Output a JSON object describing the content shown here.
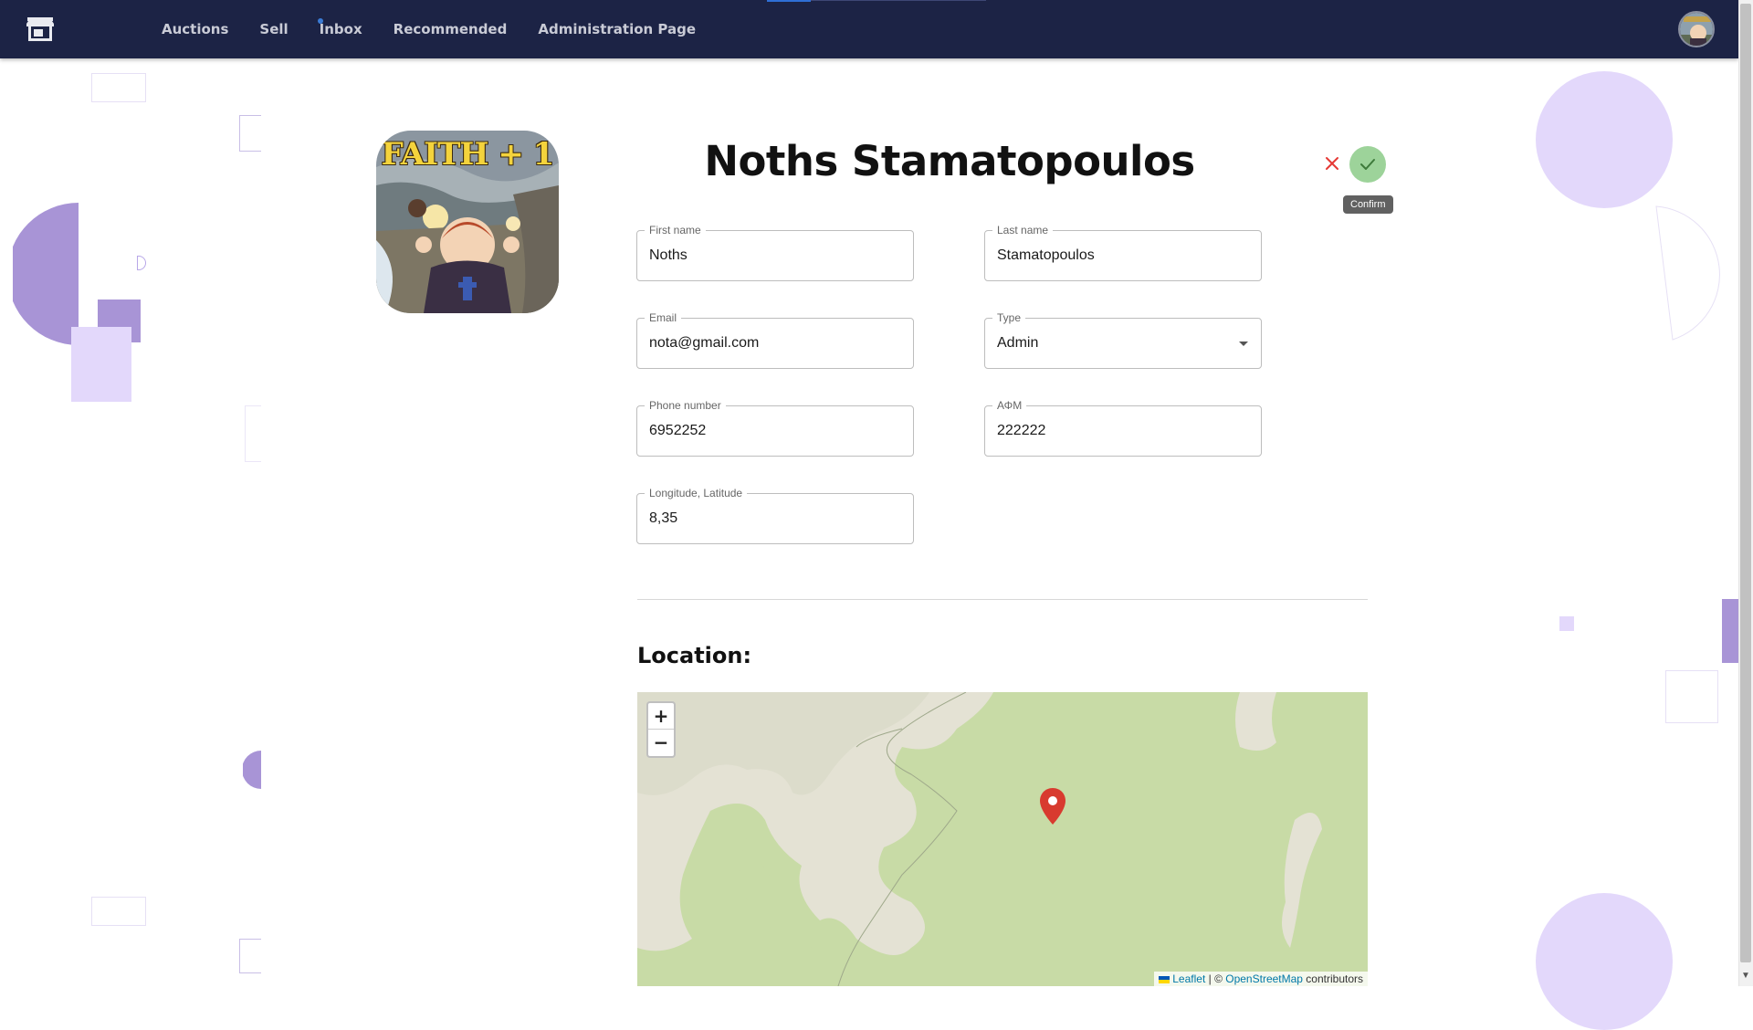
{
  "nav": {
    "links": [
      "Auctions",
      "Sell",
      "Inbox",
      "Recommended",
      "Administration Page"
    ],
    "brand_icon": "store-icon",
    "user_avatar": "avatar"
  },
  "profile": {
    "full_name": "Noths Stamatopoulos",
    "picture_caption": "FAITH + 1"
  },
  "actions": {
    "cancel_icon": "close-icon",
    "confirm_icon": "check-icon",
    "confirm_tooltip": "Confirm"
  },
  "form": {
    "first_name": {
      "label": "First name",
      "value": "Noths"
    },
    "last_name": {
      "label": "Last name",
      "value": "Stamatopoulos"
    },
    "email": {
      "label": "Email",
      "value": "nota@gmail.com"
    },
    "type": {
      "label": "Type",
      "value": "Admin"
    },
    "phone": {
      "label": "Phone number",
      "value": "6952252"
    },
    "afm": {
      "label": "ΑΦΜ",
      "value": "222222"
    },
    "coords": {
      "label": "Longitude, Latitude",
      "value": "8,35"
    }
  },
  "location": {
    "heading": "Location:",
    "zoom_in": "+",
    "zoom_out": "−",
    "attribution_leaflet": "Leaflet",
    "attribution_sep": " | © ",
    "attribution_osm": "OpenStreetMap",
    "attribution_tail": " contributors"
  },
  "colors": {
    "navbar": "#1c2345",
    "confirm": "#9dd39a",
    "cancel": "#e53935",
    "decor_purple": "#a894d6",
    "decor_lilac": "#e6dcfb",
    "map_land": "#c8dba6",
    "map_shore": "#e4e2d4"
  }
}
